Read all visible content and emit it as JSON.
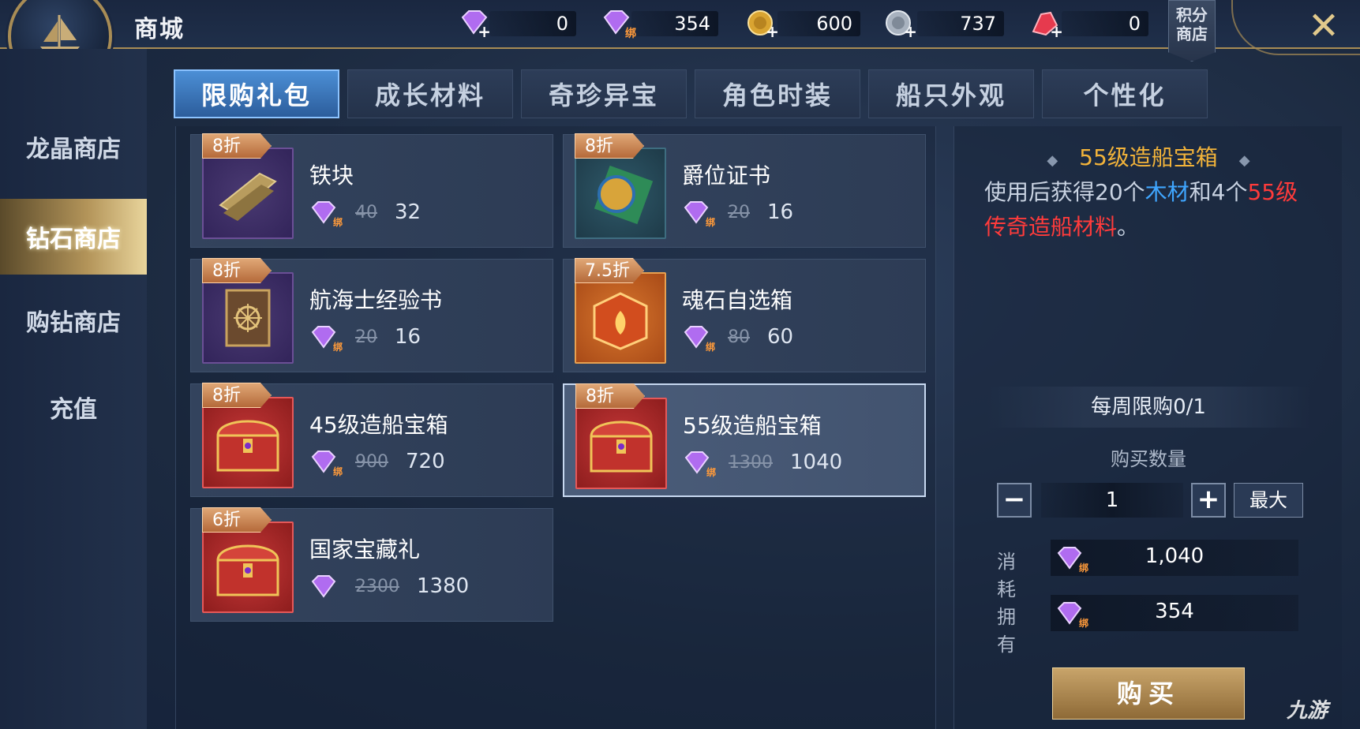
{
  "header": {
    "title": "商城",
    "points_shop_label_1": "积分",
    "points_shop_label_2": "商店"
  },
  "currencies": [
    {
      "name": "diamond-icon",
      "value": "0",
      "badge": "+"
    },
    {
      "name": "bound-diamond-icon",
      "value": "354",
      "badge": "绑"
    },
    {
      "name": "gold-coin-icon",
      "value": "600",
      "badge": "+"
    },
    {
      "name": "silver-coin-icon",
      "value": "737",
      "badge": "+"
    },
    {
      "name": "red-crystal-icon",
      "value": "0",
      "badge": "+"
    }
  ],
  "sidebar": {
    "items": [
      {
        "label": "龙晶商店",
        "active": false
      },
      {
        "label": "钻石商店",
        "active": true
      },
      {
        "label": "购钻商店",
        "active": false
      },
      {
        "label": "充值",
        "active": false
      }
    ]
  },
  "tabs": [
    {
      "label": "限购礼包",
      "active": true
    },
    {
      "label": "成长材料",
      "active": false
    },
    {
      "label": "奇珍异宝",
      "active": false
    },
    {
      "label": "角色时装",
      "active": false
    },
    {
      "label": "船只外观",
      "active": false
    },
    {
      "label": "个性化",
      "active": false
    }
  ],
  "products": [
    {
      "name": "铁块",
      "discount": "8折",
      "old_price": "40",
      "price": "32",
      "icon": "iron-ingot-icon"
    },
    {
      "name": "爵位证书",
      "discount": "8折",
      "old_price": "20",
      "price": "16",
      "icon": "title-certificate-icon"
    },
    {
      "name": "航海士经验书",
      "discount": "8折",
      "old_price": "20",
      "price": "16",
      "icon": "exp-book-icon"
    },
    {
      "name": "魂石自选箱",
      "discount": "7.5折",
      "old_price": "80",
      "price": "60",
      "icon": "soulstone-box-icon"
    },
    {
      "name": "45级造船宝箱",
      "discount": "8折",
      "old_price": "900",
      "price": "720",
      "icon": "treasure-chest-icon"
    },
    {
      "name": "55级造船宝箱",
      "discount": "8折",
      "old_price": "1300",
      "price": "1040",
      "icon": "treasure-chest-icon"
    },
    {
      "name": "国家宝藏礼",
      "discount": "6折",
      "old_price": "2300",
      "price": "1380",
      "icon": "treasure-chest-icon"
    }
  ],
  "detail": {
    "title": "55级造船宝箱",
    "desc_part1": "使用后获得20个",
    "desc_blue": "木材",
    "desc_part2": "和4个",
    "desc_red": "55级传奇造船材料",
    "desc_end": "。",
    "weekly_limit": "每周限购0/1",
    "qty_label": "购买数量",
    "qty_value": "1",
    "minus": "−",
    "plus": "+",
    "max_label": "最大",
    "cost_label": "消耗",
    "cost_value": "1,040",
    "own_label": "拥有",
    "own_value": "354",
    "buy_label": "购买"
  },
  "watermark": "九游",
  "colors": {
    "accent_gold": "#a88c55",
    "tab_active": "#3a77bf",
    "price_highlight": "#f2b33a",
    "text_blue": "#3fa6ff",
    "text_red": "#ff3b3b"
  }
}
